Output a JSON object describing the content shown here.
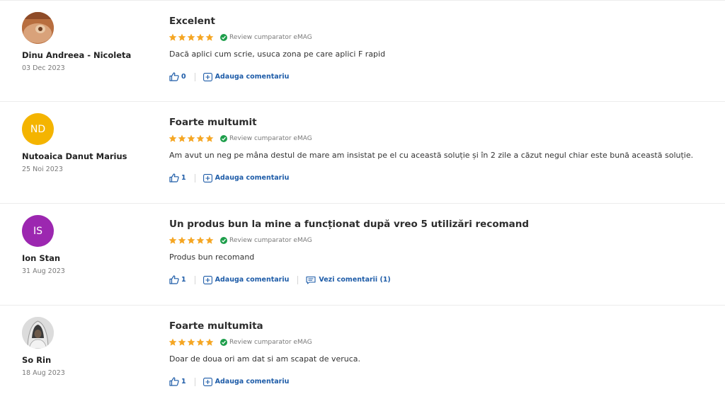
{
  "verified_label": "Review cumparator eMAG",
  "add_comment_label": "Adauga comentariu",
  "colors": {
    "link": "#1e5ca8",
    "star": "#f5a623",
    "verified": "#1e9e4b"
  },
  "reviews": [
    {
      "author": "Dinu Andreea - Nicoleta",
      "date": "03 Dec 2023",
      "avatar": {
        "type": "photo",
        "icon": "user-photo"
      },
      "title": "Excelent",
      "rating": 5,
      "text": "Dacă aplici cum scrie, usuca zona pe care aplici F rapid",
      "likes": "0"
    },
    {
      "author": "Nutoaica Danut Marius",
      "date": "25 Noi 2023",
      "avatar": {
        "type": "initials",
        "initials": "ND",
        "color": "#f4b400"
      },
      "title": "Foarte multumit",
      "rating": 5,
      "text": "Am avut un neg pe mâna destul de mare am insistat pe el cu această soluție și în 2 zile a căzut negul chiar este bună această soluție.",
      "likes": "1"
    },
    {
      "author": "Ion Stan",
      "date": "31 Aug 2023",
      "avatar": {
        "type": "initials",
        "initials": "IS",
        "color": "#9c27b0"
      },
      "title": "Un produs bun la mine a funcționat după vreo 5 utilizări recomand",
      "rating": 5,
      "text": "Produs bun recomand",
      "likes": "1",
      "view_comments_label": "Vezi comentarii (1)"
    },
    {
      "author": "So Rin",
      "date": "18 Aug 2023",
      "avatar": {
        "type": "photo",
        "icon": "hooded-figure-photo"
      },
      "title": "Foarte multumita",
      "rating": 5,
      "text": "Doar de doua ori am dat si am scapat de veruca.",
      "likes": "1"
    }
  ]
}
